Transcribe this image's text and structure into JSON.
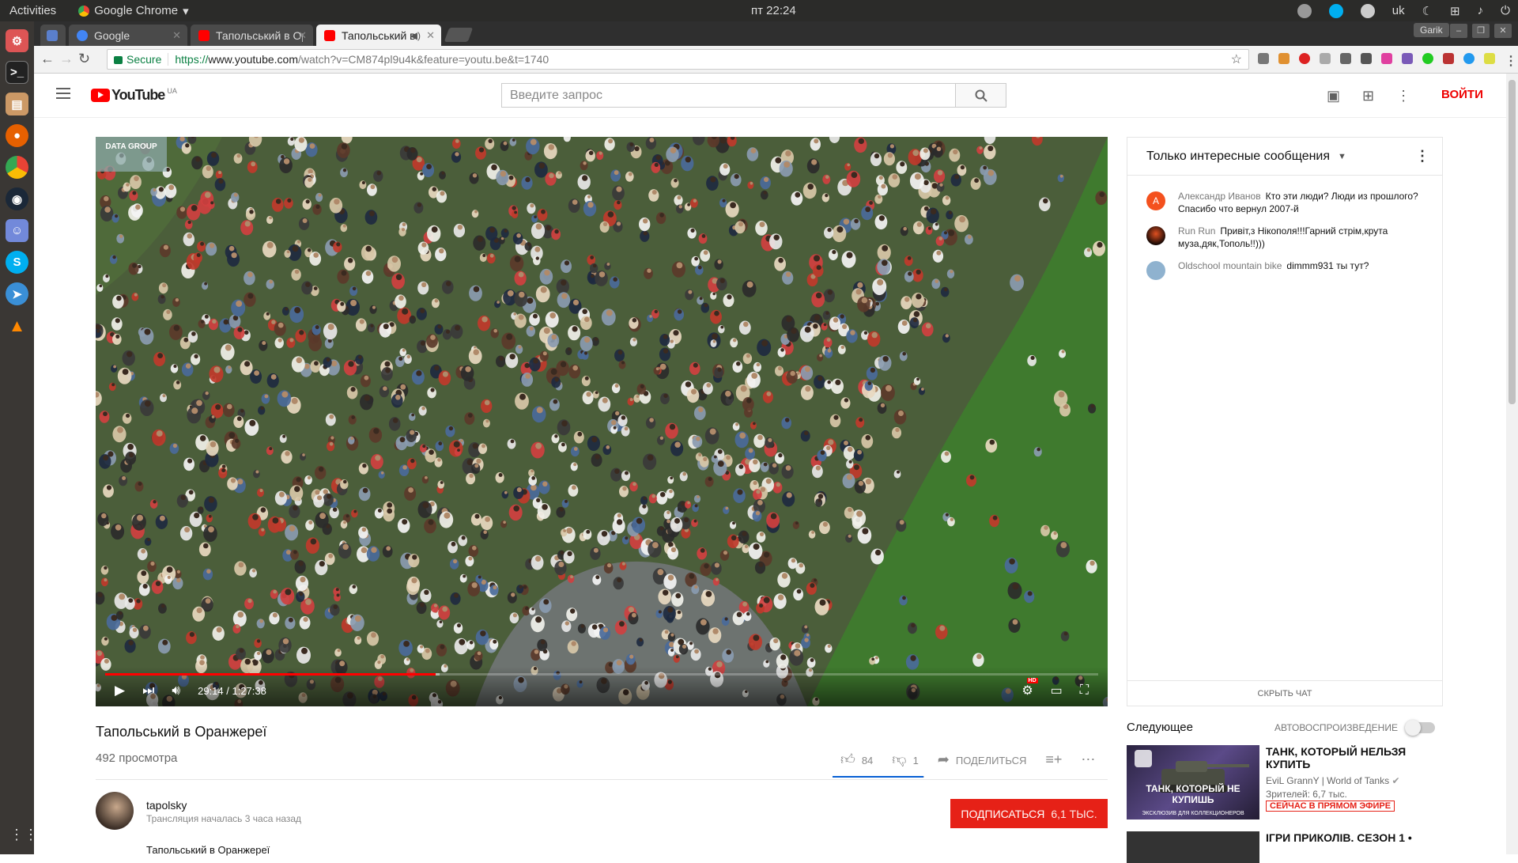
{
  "desktop": {
    "activities": "Activities",
    "app_menu": "Google Chrome",
    "clock": "пт 22:24",
    "keyboard_layout": "uk"
  },
  "browser": {
    "tabs": [
      {
        "label": "Google",
        "favicon_color": "#4285f4"
      },
      {
        "label": "Тапольський в Оран",
        "favicon_color": "#ff0000"
      },
      {
        "label": "Тапольський в Ор",
        "favicon_color": "#ff0000"
      }
    ],
    "profile_name": "Garik",
    "secure_label": "Secure",
    "url": {
      "scheme": "https://",
      "host": "www.youtube.com",
      "path": "/watch?v=CM874pl9u4k&feature=youtu.be&t=1740"
    }
  },
  "youtube": {
    "logo_text": "YouTube",
    "country_code": "UA",
    "search_placeholder": "Введите запрос",
    "sign_in": "ВОЙТИ",
    "player": {
      "watermark": "DATA GROUP",
      "time": "29:14 / 1:27:38",
      "progress_fraction": 0.333,
      "buffered_fraction": 0.337
    },
    "video": {
      "title": "Тапольський в Оранжереї",
      "views": "492 просмотра",
      "likes": "84",
      "dislikes": "1",
      "share": "ПОДЕЛИТЬСЯ",
      "like_ratio": 0.988
    },
    "channel": {
      "name": "tapolsky",
      "meta": "Трансляция началась 3 часа назад",
      "subscribe": "ПОДПИСАТЬСЯ",
      "subscribers": "6,1 ТЫС.",
      "description": "Тапольський в Оранжереї"
    },
    "chat": {
      "filter": "Только интересные сообщения",
      "messages": [
        {
          "initial": "А",
          "avatar_color": "#f4511e",
          "author": "Александр Иванов",
          "text": "Кто эти люди? Люди из прошлого? Спасибо что вернул 2007-й"
        },
        {
          "initial": "",
          "avatar_color": "#3a1a12",
          "author": "Run Run",
          "text": "Привіт,з Нікополя!!!Гарний стрім,крута муза,дяк,Тополь!!)))"
        },
        {
          "initial": "",
          "avatar_color": "#8fb2cf",
          "author": "Oldschool mountain bike",
          "text": "dimmm931 ты тут?"
        }
      ],
      "hide": "СКРЫТЬ ЧАТ"
    },
    "up_next": {
      "heading": "Следующее",
      "autoplay": "АВТОВОСПРОИЗВЕДЕНИЕ",
      "card": {
        "thumb_caption": "ТАНК, КОТОРЫЙ НЕ КУПИШЬ",
        "thumb_sub": "ЭКСКЛЮЗИВ ДЛЯ КОЛЛЕКЦИОНЕРОВ",
        "title": "ТАНК, КОТОРЫЙ НЕЛЬЗЯ КУПИТЬ",
        "channel": "EviL GrannY | World of Tanks",
        "viewers": "Зрителей: 6,7 тыс.",
        "live": "СЕЙЧАС В ПРЯМОМ ЭФИРЕ"
      },
      "card2_title": "ІГРИ ПРИКОЛІВ. СЕЗОН 1 •"
    }
  }
}
